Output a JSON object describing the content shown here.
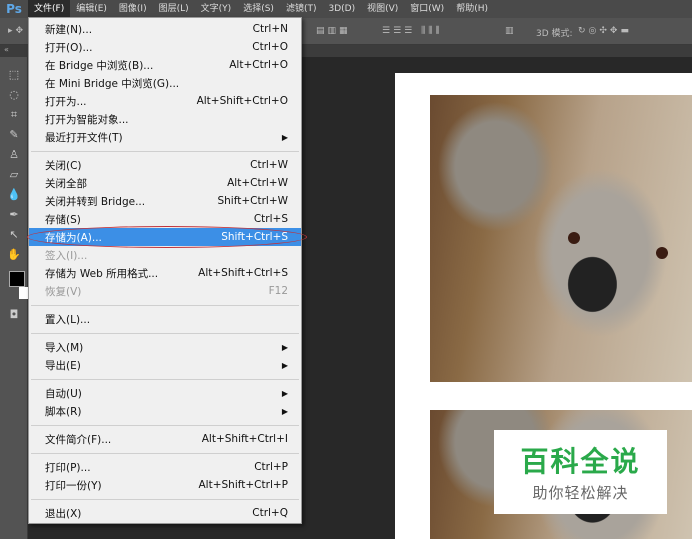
{
  "app": {
    "logo": "Ps"
  },
  "menubar": [
    {
      "label": "文件(F)"
    },
    {
      "label": "编辑(E)"
    },
    {
      "label": "图像(I)"
    },
    {
      "label": "图层(L)"
    },
    {
      "label": "文字(Y)"
    },
    {
      "label": "选择(S)"
    },
    {
      "label": "滤镜(T)"
    },
    {
      "label": "3D(D)"
    },
    {
      "label": "视图(V)"
    },
    {
      "label": "窗口(W)"
    },
    {
      "label": "帮助(H)"
    }
  ],
  "options": {
    "mode3d": "3D 模式:"
  },
  "file_menu": [
    {
      "label": "新建(N)...",
      "shortcut": "Ctrl+N"
    },
    {
      "label": "打开(O)...",
      "shortcut": "Ctrl+O"
    },
    {
      "label": "在 Bridge 中浏览(B)...",
      "shortcut": "Alt+Ctrl+O"
    },
    {
      "label": "在 Mini Bridge 中浏览(G)...",
      "shortcut": ""
    },
    {
      "label": "打开为...",
      "shortcut": "Alt+Shift+Ctrl+O"
    },
    {
      "label": "打开为智能对象...",
      "shortcut": ""
    },
    {
      "label": "最近打开文件(T)",
      "shortcut": ""
    },
    {
      "label": "关闭(C)",
      "shortcut": "Ctrl+W"
    },
    {
      "label": "关闭全部",
      "shortcut": "Alt+Ctrl+W"
    },
    {
      "label": "关闭并转到 Bridge...",
      "shortcut": "Shift+Ctrl+W"
    },
    {
      "label": "存储(S)",
      "shortcut": "Ctrl+S"
    },
    {
      "label": "存储为(A)...",
      "shortcut": "Shift+Ctrl+S"
    },
    {
      "label": "签入(I)...",
      "shortcut": ""
    },
    {
      "label": "存储为 Web 所用格式...",
      "shortcut": "Alt+Shift+Ctrl+S"
    },
    {
      "label": "恢复(V)",
      "shortcut": "F12"
    },
    {
      "label": "置入(L)...",
      "shortcut": ""
    },
    {
      "label": "导入(M)",
      "shortcut": ""
    },
    {
      "label": "导出(E)",
      "shortcut": ""
    },
    {
      "label": "自动(U)",
      "shortcut": ""
    },
    {
      "label": "脚本(R)",
      "shortcut": ""
    },
    {
      "label": "文件简介(F)...",
      "shortcut": "Alt+Shift+Ctrl+I"
    },
    {
      "label": "打印(P)...",
      "shortcut": "Ctrl+P"
    },
    {
      "label": "打印一份(Y)",
      "shortcut": "Alt+Shift+Ctrl+P"
    },
    {
      "label": "退出(X)",
      "shortcut": "Ctrl+Q"
    }
  ],
  "watermark": {
    "title": "百科全说",
    "subtitle": "助你轻松解决"
  },
  "colors": {
    "highlight": "#3c8fe6",
    "annotation": "#c0323a",
    "watermark": "#2aa94a"
  }
}
